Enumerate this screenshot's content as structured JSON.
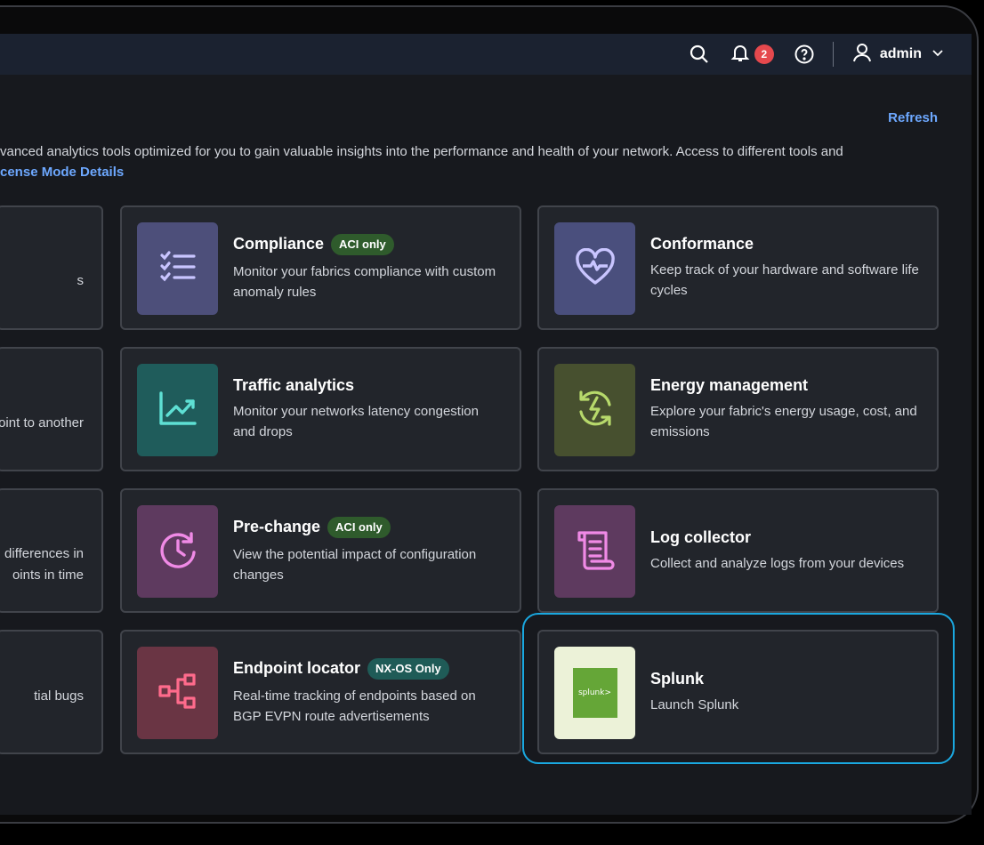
{
  "header": {
    "notifications_count": "2",
    "user": "admin"
  },
  "refresh_label": "Refresh",
  "description": {
    "line1": "vanced analytics tools optimized for you to gain valuable insights into the performance and health of your network. Access to different tools and",
    "line2": "cense Mode Details"
  },
  "stubs": {
    "row1": "s",
    "row2": "oint to another",
    "row3_a": "differences in",
    "row3_b": "oints in time",
    "row4": "tial bugs"
  },
  "cards": {
    "compliance": {
      "title": "Compliance",
      "tag": "ACI only",
      "desc": "Monitor your fabrics compliance with custom anomaly rules",
      "tile_color": "#4d4f7a",
      "icon_color": "#c9c5ff"
    },
    "conformance": {
      "title": "Conformance",
      "desc": "Keep track of your hardware and software life cycles",
      "tile_color": "#4a4f7d",
      "icon_color": "#c9c5ff"
    },
    "traffic": {
      "title": "Traffic analytics",
      "desc": "Monitor your networks latency congestion and drops",
      "tile_color": "#1f5c5b",
      "icon_color": "#5ee0d4"
    },
    "energy": {
      "title": "Energy management",
      "desc": "Explore your fabric's energy usage, cost, and emissions",
      "tile_color": "#47502f",
      "icon_color": "#b7d96b"
    },
    "prechange": {
      "title": "Pre-change",
      "tag": "ACI only",
      "desc": "View the potential impact of configuration changes",
      "tile_color": "#5e3a5f",
      "icon_color": "#f08ae6"
    },
    "logcollector": {
      "title": "Log collector",
      "desc": "Collect and analyze logs from your devices",
      "tile_color": "#5e3a5f",
      "icon_color": "#f08ae6"
    },
    "endpoint": {
      "title": "Endpoint locator",
      "tag": "NX-OS Only",
      "desc": "Real-time tracking of endpoints based on BGP EVPN route advertisements",
      "tile_color": "#6a3544",
      "icon_color": "#ff6b8c"
    },
    "splunk": {
      "title": "Splunk",
      "desc": "Launch Splunk",
      "tile_color": "#ecf2d8",
      "logo_text": "splunk>"
    }
  }
}
